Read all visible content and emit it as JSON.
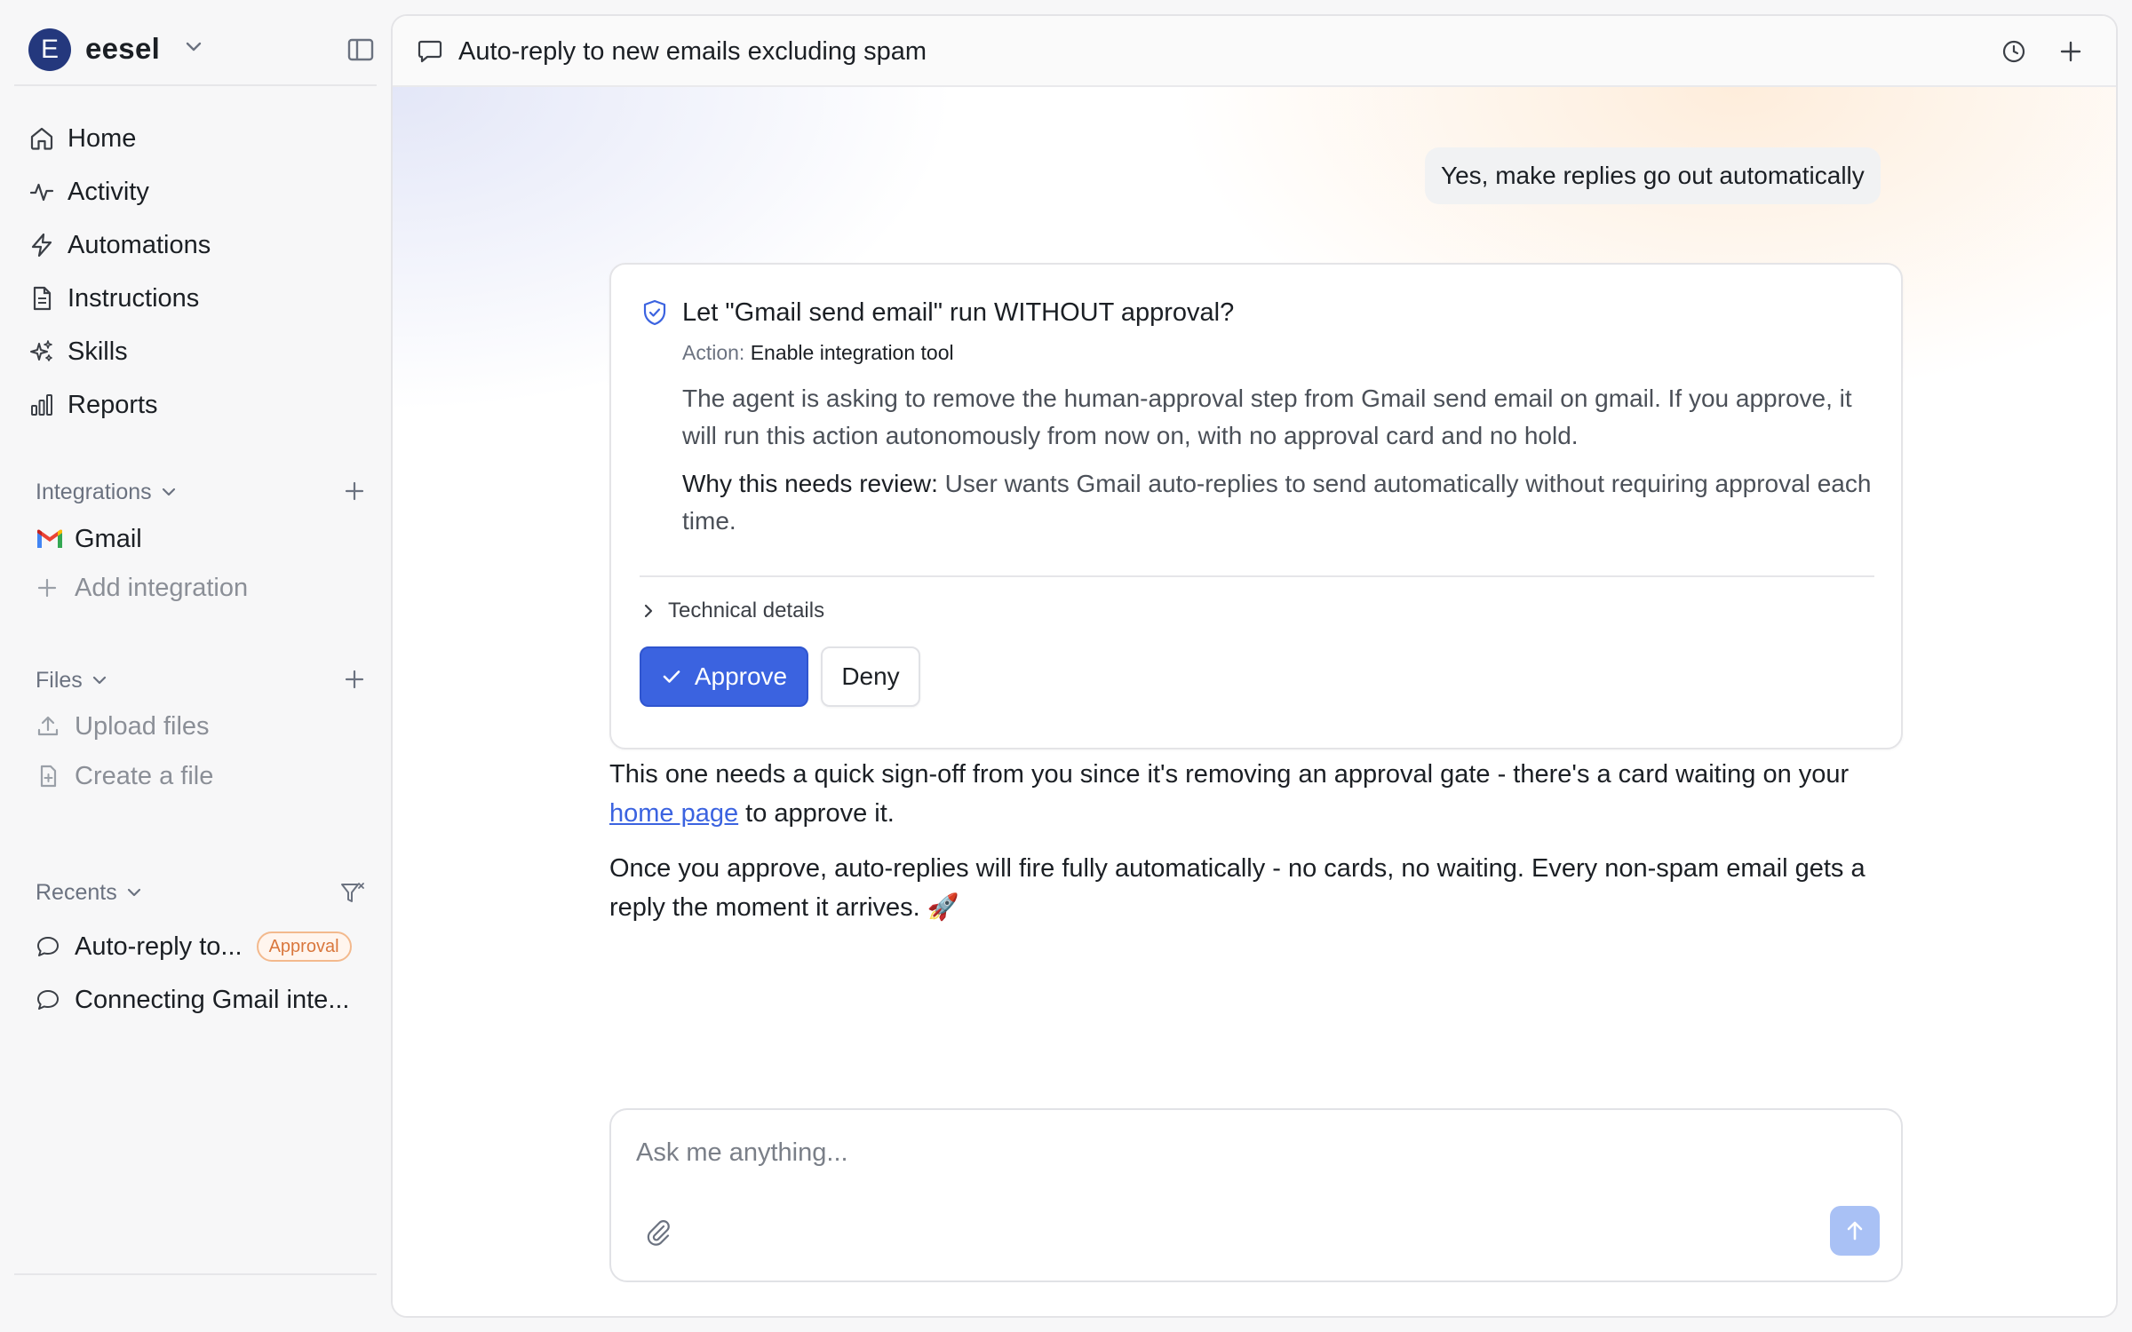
{
  "workspace": {
    "initial": "E",
    "name": "eesel"
  },
  "nav": [
    {
      "label": "Home",
      "icon": "home-icon"
    },
    {
      "label": "Activity",
      "icon": "activity-icon"
    },
    {
      "label": "Automations",
      "icon": "lightning-icon"
    },
    {
      "label": "Instructions",
      "icon": "document-icon"
    },
    {
      "label": "Skills",
      "icon": "sparkle-icon"
    },
    {
      "label": "Reports",
      "icon": "bar-chart-icon"
    }
  ],
  "integrations": {
    "heading": "Integrations",
    "items": [
      {
        "label": "Gmail",
        "icon": "gmail-icon"
      }
    ],
    "add_label": "Add integration"
  },
  "files": {
    "heading": "Files",
    "upload_label": "Upload files",
    "create_label": "Create a file"
  },
  "recents": {
    "heading": "Recents",
    "items": [
      {
        "label": "Auto-reply to...",
        "badge": "Approval"
      },
      {
        "label": "Connecting Gmail inte..."
      }
    ]
  },
  "chat": {
    "title": "Auto-reply to new emails excluding spam",
    "user_message": "Yes, make replies go out automatically",
    "approval_card": {
      "title": "Let \"Gmail send email\" run WITHOUT approval?",
      "action_key": "Action:",
      "action_value": "Enable integration tool",
      "description": "The agent is asking to remove the human-approval step from Gmail send email on gmail. If you approve, it will run this action autonomously from now on, with no approval card and no hold.",
      "why_key": "Why this needs review:",
      "why_value": "User wants Gmail auto-replies to send automatically without requiring approval each time.",
      "technical_label": "Technical details",
      "approve_label": "Approve",
      "deny_label": "Deny"
    },
    "reply_1_before": "This one needs a quick sign-off from you since it's removing an approval gate - there's a card waiting on your ",
    "reply_1_link": "home page",
    "reply_1_after": " to approve it.",
    "reply_2": "Once you approve, auto-replies will fire fully automatically - no cards, no waiting. Every non-spam email gets a reply the moment it arrives. 🚀"
  },
  "composer": {
    "placeholder": "Ask me anything..."
  },
  "colors": {
    "accent": "#3b63e0",
    "badge_orange": "#d9773d",
    "avatar": "#24387d"
  }
}
